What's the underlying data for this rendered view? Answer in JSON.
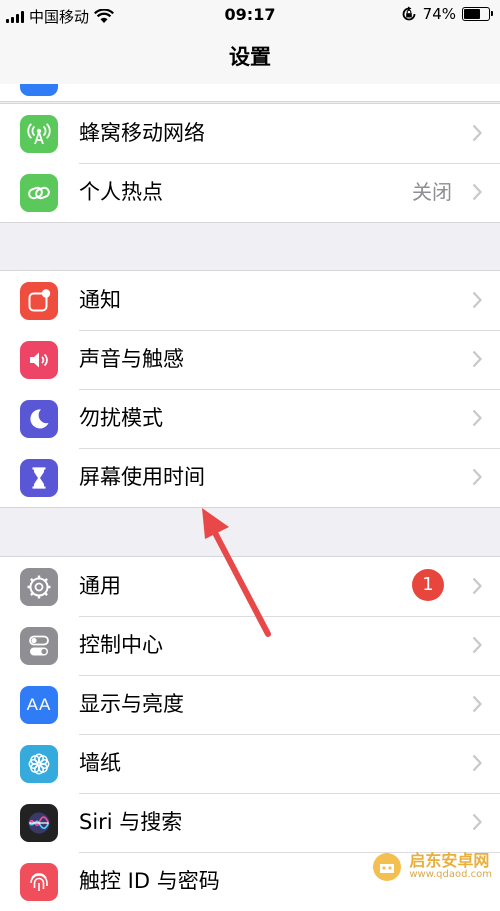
{
  "status_bar": {
    "carrier": "中国移动",
    "time": "09:17",
    "battery_percent": "74%",
    "battery_level": 0.74
  },
  "nav": {
    "title": "设置"
  },
  "colors": {
    "cellular": "#5ac85a",
    "hotspot": "#5ac85a",
    "notifications": "#ef4e3f",
    "sounds": "#ee4466",
    "dnd": "#5a57d6",
    "screen_time": "#5a57d6",
    "general": "#8e8e93",
    "control_center": "#8e8e93",
    "display": "#2f7cf6",
    "wallpaper": "#35aadc",
    "siri": "#222222",
    "touchid": "#ef4e5a",
    "badge": "#e8453c"
  },
  "group1": {
    "items": [
      {
        "label": "蜂窝移动网络",
        "icon": "antenna-icon"
      },
      {
        "label": "个人热点",
        "value": "关闭",
        "icon": "hotspot-link-icon"
      }
    ]
  },
  "group2": {
    "items": [
      {
        "label": "通知",
        "icon": "notifications-icon"
      },
      {
        "label": "声音与触感",
        "icon": "speaker-icon"
      },
      {
        "label": "勿扰模式",
        "icon": "moon-icon"
      },
      {
        "label": "屏幕使用时间",
        "icon": "hourglass-icon"
      }
    ]
  },
  "group3": {
    "items": [
      {
        "label": "通用",
        "badge": "1",
        "icon": "gear-icon"
      },
      {
        "label": "控制中心",
        "icon": "toggles-icon"
      },
      {
        "label": "显示与亮度",
        "icon": "aa-icon",
        "icon_text": "AA"
      },
      {
        "label": "墙纸",
        "icon": "flower-icon"
      },
      {
        "label": "Siri 与搜索",
        "icon": "siri-icon"
      },
      {
        "label": "触控 ID 与密码",
        "icon": "fingerprint-icon"
      }
    ]
  },
  "watermark": {
    "name": "启东安卓网",
    "url": "www.qdaod.com"
  }
}
